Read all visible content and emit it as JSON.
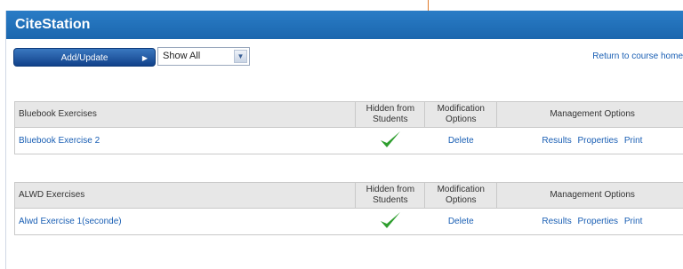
{
  "app": {
    "title": "CiteStation"
  },
  "toolbar": {
    "add_update_label": "Add/Update",
    "filter_selected": "Show All",
    "return_link": "Return to course home"
  },
  "columns": {
    "hidden": "Hidden from Students",
    "modification": "Modification Options",
    "management": "Management Options"
  },
  "sections": [
    {
      "heading": "Bluebook Exercises",
      "items": [
        {
          "name": "Bluebook Exercise 2",
          "hidden_icon": "checkmark-icon",
          "delete": "Delete",
          "results": "Results",
          "properties": "Properties",
          "print": "Print"
        }
      ]
    },
    {
      "heading": "ALWD Exercises",
      "items": [
        {
          "name": "Alwd Exercise 1(seconde)",
          "hidden_icon": "checkmark-icon",
          "delete": "Delete",
          "results": "Results",
          "properties": "Properties",
          "print": "Print"
        }
      ]
    }
  ],
  "colors": {
    "titlebar": "#1f6fb8",
    "link": "#1a5fb4",
    "check": "#2e9e2e",
    "header_bg": "#e7e7e7"
  }
}
